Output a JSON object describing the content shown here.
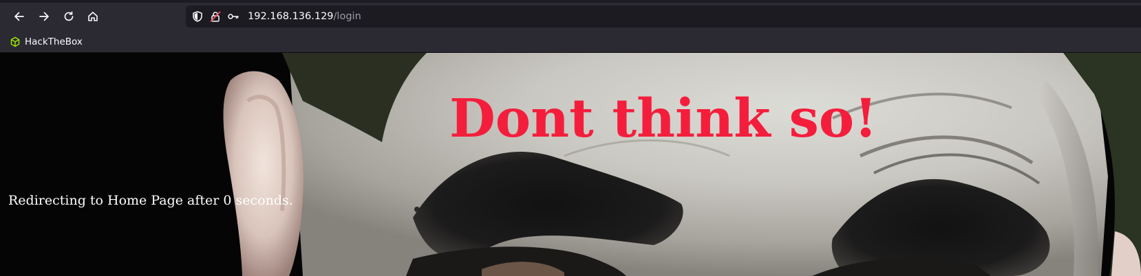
{
  "browser": {
    "url_host": "192.168.136.129",
    "url_path": "/login",
    "nav_icons": [
      "back-arrow-icon",
      "forward-arrow-icon",
      "reload-icon",
      "home-icon"
    ],
    "url_icons": [
      "shield-icon",
      "insecure-lock-icon",
      "key-icon"
    ]
  },
  "bookmarks": {
    "items": [
      {
        "label": "HackTheBox",
        "icon": "hackthebox-cube-icon",
        "icon_color": "#9fef00"
      }
    ]
  },
  "page": {
    "headline": "Dont think so!",
    "redirect_text": "Redirecting to Home Page after 0 seconds.",
    "headline_color": "#f41e3c",
    "background": "joker-face-photo"
  }
}
